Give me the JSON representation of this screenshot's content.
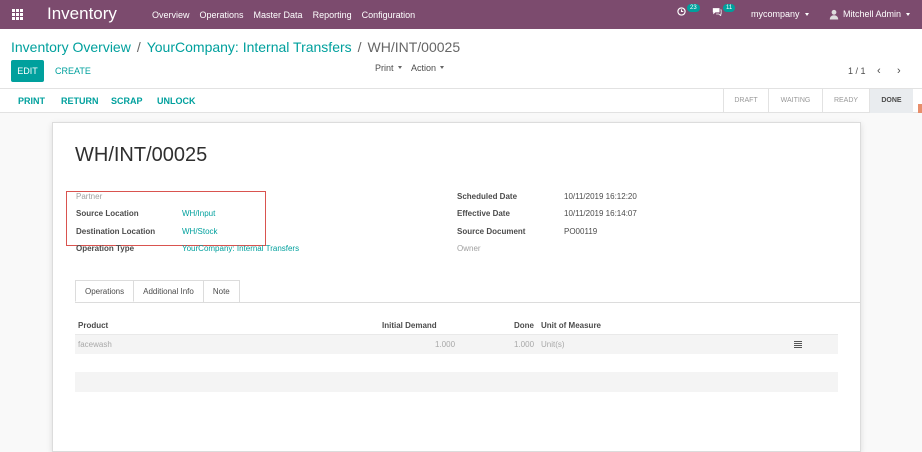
{
  "navbar": {
    "brand": "Inventory",
    "menu": [
      "Overview",
      "Operations",
      "Master Data",
      "Reporting",
      "Configuration"
    ],
    "activity_count": "23",
    "messages_count": "11",
    "company": "mycompany",
    "user": "Mitchell Admin"
  },
  "breadcrumb": {
    "root": "Inventory Overview",
    "parent": "YourCompany: Internal Transfers",
    "current": "WH/INT/00025",
    "separator": "/"
  },
  "control": {
    "edit_label": "EDIT",
    "create_label": "CREATE",
    "print_label": "Print",
    "action_label": "Action",
    "pager": "1 / 1",
    "prev": "‹",
    "next": "›"
  },
  "header": {
    "buttons": [
      "PRINT",
      "RETURN",
      "SCRAP",
      "UNLOCK"
    ],
    "stages": [
      "DRAFT",
      "WAITING",
      "READY",
      "DONE"
    ],
    "active_stage": "DONE"
  },
  "record": {
    "name": "WH/INT/00025",
    "left": {
      "partner_label": "Partner",
      "source_location_label": "Source Location",
      "source_location": "WH/Input",
      "destination_location_label": "Destination Location",
      "destination_location": "WH/Stock",
      "operation_type_label": "Operation Type",
      "operation_type": "YourCompany: Internal Transfers"
    },
    "right": {
      "scheduled_date_label": "Scheduled Date",
      "scheduled_date": "10/11/2019 16:12:20",
      "effective_date_label": "Effective Date",
      "effective_date": "10/11/2019 16:14:07",
      "source_document_label": "Source Document",
      "source_document": "PO00119",
      "owner_label": "Owner"
    }
  },
  "tabs": [
    "Operations",
    "Additional Info",
    "Note"
  ],
  "operations": {
    "columns": [
      "Product",
      "Initial Demand",
      "Done",
      "Unit of Measure"
    ],
    "rows": [
      {
        "product": "facewash",
        "initial_demand": "1.000",
        "done": "1.000",
        "uom": "Unit(s)"
      }
    ]
  },
  "colors": {
    "navbar": "#7c4b6e",
    "accent": "#00a09d",
    "highlight_box": "#d9534f"
  }
}
